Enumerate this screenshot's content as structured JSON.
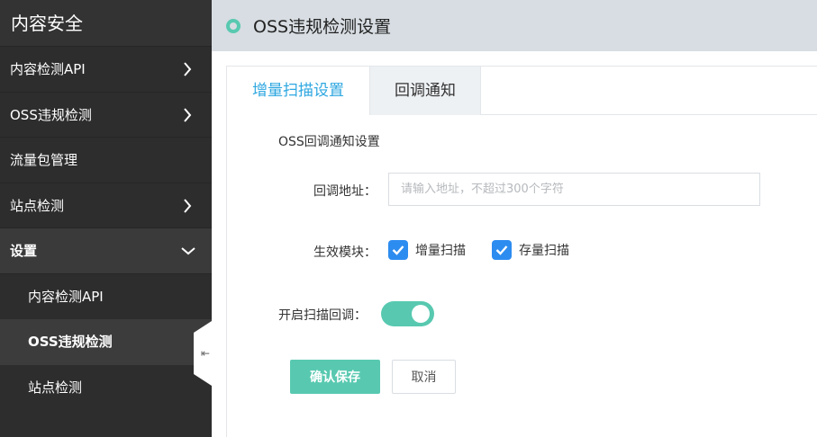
{
  "sidebar": {
    "title": "内容安全",
    "items": [
      {
        "label": "内容检测API"
      },
      {
        "label": "OSS违规检测"
      },
      {
        "label": "流量包管理"
      },
      {
        "label": "站点检测"
      },
      {
        "label": "设置"
      }
    ],
    "sub_items": [
      {
        "label": "内容检测API"
      },
      {
        "label": "OSS违规检测"
      },
      {
        "label": "站点检测"
      }
    ],
    "collapse_glyph": "⇤"
  },
  "header": {
    "title": "OSS违规检测设置"
  },
  "tabs": [
    {
      "label": "增量扫描设置"
    },
    {
      "label": "回调通知"
    }
  ],
  "form": {
    "section_title": "OSS回调通知设置",
    "url_label": "回调地址：",
    "url_value": "",
    "url_placeholder": "请输入地址，不超过300个字符",
    "modules_label": "生效模块：",
    "checkbox_incremental": "增量扫描",
    "checkbox_stock": "存量扫描",
    "checkbox_incremental_checked": true,
    "checkbox_stock_checked": true,
    "switch_label": "开启扫描回调：",
    "switch_on": true,
    "save_label": "确认保存",
    "cancel_label": "取消"
  },
  "colors": {
    "accent_teal": "#58c9b0",
    "tab_active_blue": "#2ea7e0",
    "checkbox_blue": "#2d8cf0",
    "sidebar_bg": "#2d2d2d",
    "header_bg": "#d7dde2"
  }
}
